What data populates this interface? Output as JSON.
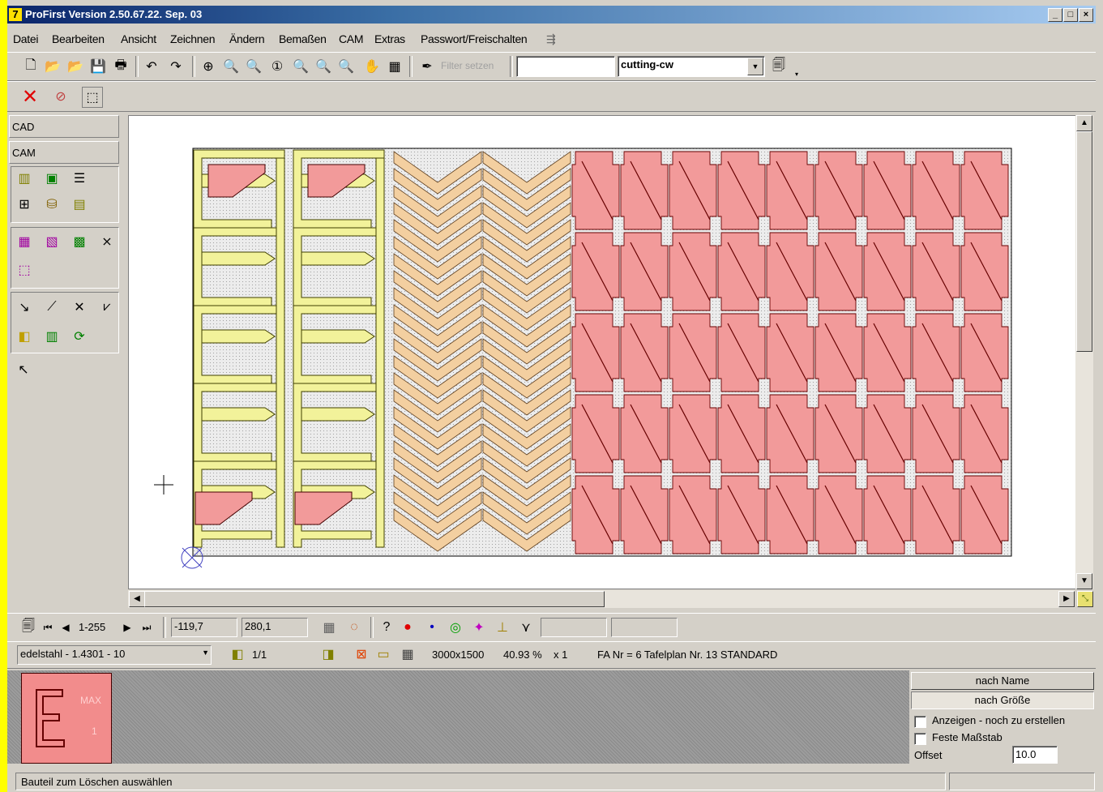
{
  "window": {
    "title": "ProFirst Version 2.50.67.22. Sep. 03",
    "app_icon_text": "7",
    "minimize": "_",
    "maximize": "□",
    "close": "×"
  },
  "menu": [
    "Datei",
    "Bearbeiten",
    "Ansicht",
    "Zeichnen",
    "Ändern",
    "Bemaßen",
    "CAM",
    "Extras",
    "Passwort/Freischalten"
  ],
  "toolbar": {
    "filter_button": "Filter setzen",
    "layer_select": "cutting-cw"
  },
  "side_panel": {
    "cad_label": "CAD",
    "cam_label": "CAM"
  },
  "nav_bar": {
    "page_range": "1-255",
    "coord_x": "-119,7",
    "coord_y": "280,1"
  },
  "info_bar": {
    "material": "edelstahl - 1.4301 - 10",
    "sheet_index": "1/1",
    "sheet_size": "3000x1500",
    "utilization": "40.93 %",
    "multiplier": "x 1",
    "job_info": "FA Nr = 6 Tafelplan Nr. 13 STANDARD"
  },
  "preview": {
    "max_label": "MAX",
    "count_label": "1"
  },
  "sort_panel": {
    "by_name": "nach Name",
    "by_size": "nach Größe",
    "show_remaining": "Anzeigen - noch zu erstellen",
    "fixed_scale": "Feste Maßstab",
    "offset_label": "Offset",
    "offset_value": "10.0"
  },
  "status": {
    "message": "Bauteil zum Löschen auswählen"
  },
  "colors": {
    "sheet": "#d8d8d8",
    "part_yellow": "#f2f29a",
    "part_peach": "#f3cfa0",
    "part_pink": "#f29a9a"
  }
}
